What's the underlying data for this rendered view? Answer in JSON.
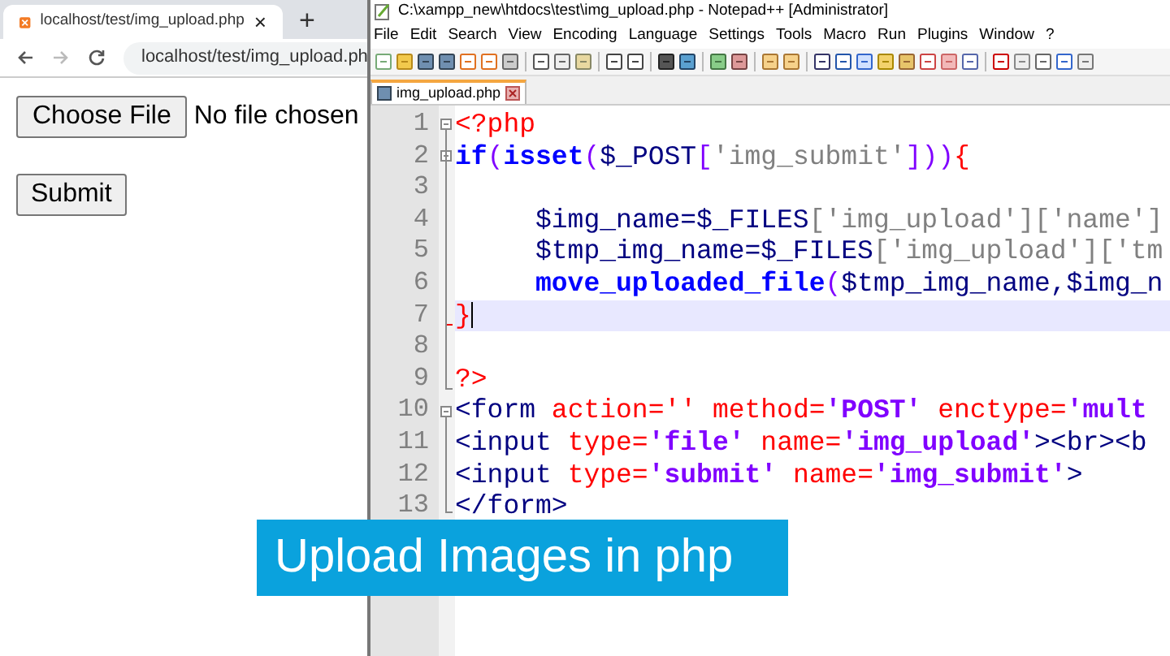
{
  "browser": {
    "tab": {
      "title": "localhost/test/img_upload.php",
      "close": "×"
    },
    "new_tab": "+",
    "address": "localhost/test/img_upload.ph",
    "page": {
      "file_button": "Choose File",
      "file_status": "No file chosen",
      "submit_button": "Submit"
    }
  },
  "editor": {
    "window_title": "C:\\xampp_new\\htdocs\\test\\img_upload.php - Notepad++ [Administrator]",
    "menu": [
      "File",
      "Edit",
      "Search",
      "View",
      "Encoding",
      "Language",
      "Settings",
      "Tools",
      "Macro",
      "Run",
      "Plugins",
      "Window",
      "?"
    ],
    "tabs": [
      {
        "label": "img_upload.php",
        "selected": true
      }
    ],
    "lines": [
      {
        "number": "1",
        "current": false,
        "tokens": [
          {
            "text": "<?php",
            "kind": "delim"
          }
        ]
      },
      {
        "number": "2",
        "current": false,
        "tokens": [
          {
            "text": "if",
            "kind": "keyword"
          },
          {
            "text": "(",
            "kind": "punct"
          },
          {
            "text": "isset",
            "kind": "keyword"
          },
          {
            "text": "(",
            "kind": "punct"
          },
          {
            "text": "$_POST",
            "kind": "variable"
          },
          {
            "text": "[",
            "kind": "punct"
          },
          {
            "text": "'img_submit'",
            "kind": "string"
          },
          {
            "text": "]))",
            "kind": "punct"
          },
          {
            "text": "{",
            "kind": "delim"
          }
        ]
      },
      {
        "number": "3",
        "current": false
      },
      {
        "number": "4",
        "current": false,
        "tokens": [
          {
            "text": "     $img_name=$_FILES",
            "kind": "variable"
          },
          {
            "text": "['img_upload']['name']",
            "kind": "string"
          }
        ]
      },
      {
        "number": "5",
        "current": false,
        "tokens": [
          {
            "text": "     $tmp_img_name=$_FILES",
            "kind": "variable"
          },
          {
            "text": "['img_upload']['tm",
            "kind": "string"
          }
        ]
      },
      {
        "number": "6",
        "current": false,
        "tokens": [
          {
            "text": "     move_uploaded_file",
            "kind": "keyword"
          },
          {
            "text": "(",
            "kind": "punct"
          },
          {
            "text": "$tmp_img_name,$img_n",
            "kind": "variable"
          }
        ]
      },
      {
        "number": "7",
        "current": true,
        "tokens": [
          {
            "text": "}",
            "kind": "delim"
          }
        ]
      },
      {
        "number": "8",
        "current": false
      },
      {
        "number": "9",
        "current": false,
        "tokens": [
          {
            "text": "?>",
            "kind": "delim"
          }
        ]
      },
      {
        "number": "10",
        "current": false,
        "tokens": [
          {
            "text": "<form",
            "kind": "tag"
          },
          {
            "text": " action=''",
            "kind": "attr"
          },
          {
            "text": " method=",
            "kind": "attr"
          },
          {
            "text": "'POST'",
            "kind": "value"
          },
          {
            "text": " enctype=",
            "kind": "attr"
          },
          {
            "text": "'mult",
            "kind": "value"
          }
        ]
      },
      {
        "number": "11",
        "current": false,
        "tokens": [
          {
            "text": "<input",
            "kind": "tag"
          },
          {
            "text": " type=",
            "kind": "attr"
          },
          {
            "text": "'file'",
            "kind": "value"
          },
          {
            "text": " name=",
            "kind": "attr"
          },
          {
            "text": "'img_upload'",
            "kind": "value"
          },
          {
            "text": "><br><b",
            "kind": "tag"
          }
        ]
      },
      {
        "number": "12",
        "current": false,
        "tokens": [
          {
            "text": "<input",
            "kind": "tag"
          },
          {
            "text": " type=",
            "kind": "attr"
          },
          {
            "text": "'submit'",
            "kind": "value"
          },
          {
            "text": " name=",
            "kind": "attr"
          },
          {
            "text": "'img_submit'",
            "kind": "value"
          },
          {
            "text": ">",
            "kind": "tag"
          }
        ]
      },
      {
        "number": "13",
        "current": false,
        "tokens": [
          {
            "text": "</form>",
            "kind": "tag"
          }
        ]
      }
    ]
  },
  "caption": "Upload Images in php"
}
